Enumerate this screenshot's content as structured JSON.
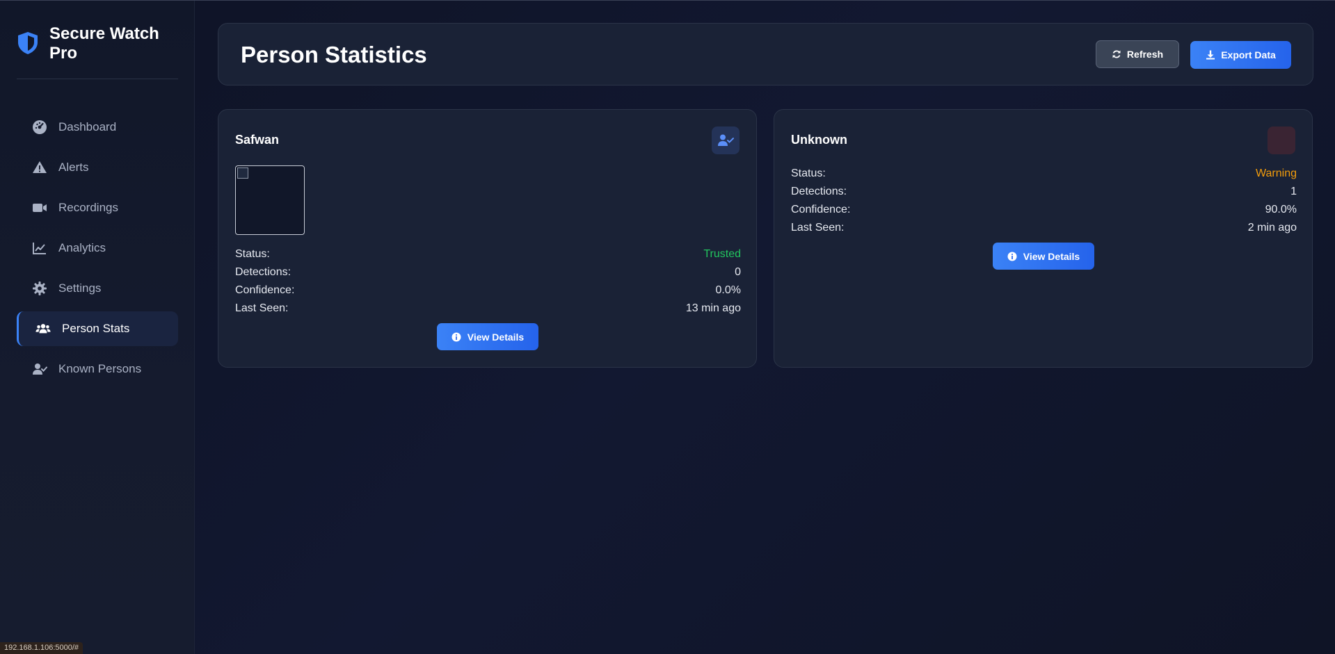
{
  "app": {
    "name": "Secure Watch Pro"
  },
  "sidebar": {
    "items": [
      {
        "label": "Dashboard",
        "icon": "dashboard-icon",
        "active": false
      },
      {
        "label": "Alerts",
        "icon": "warning-icon",
        "active": false
      },
      {
        "label": "Recordings",
        "icon": "video-icon",
        "active": false
      },
      {
        "label": "Analytics",
        "icon": "chart-line-icon",
        "active": false
      },
      {
        "label": "Settings",
        "icon": "gear-icon",
        "active": false
      },
      {
        "label": "Person Stats",
        "icon": "users-icon",
        "active": true
      },
      {
        "label": "Known Persons",
        "icon": "user-check-icon",
        "active": false
      }
    ]
  },
  "header": {
    "title": "Person Statistics",
    "refresh_label": "Refresh",
    "export_label": "Export Data"
  },
  "persons": [
    {
      "name": "Safwan",
      "status_label": "Status:",
      "status": "Trusted",
      "detections_label": "Detections:",
      "detections": "0",
      "confidence_label": "Confidence:",
      "confidence": "0.0%",
      "last_seen_label": "Last Seen:",
      "last_seen": "13 min ago",
      "button_label": "View Details"
    },
    {
      "name": "Unknown",
      "status_label": "Status:",
      "status": "Warning",
      "detections_label": "Detections:",
      "detections": "1",
      "confidence_label": "Confidence:",
      "confidence": "90.0%",
      "last_seen_label": "Last Seen:",
      "last_seen": "2 min ago",
      "button_label": "View Details"
    }
  ],
  "statusbar": {
    "url": "192.168.1.106:5000/#"
  },
  "colors": {
    "accent": "#3b82f6",
    "trusted": "#22c55e",
    "warning": "#f59e0b",
    "background": "#0f1426",
    "card": "#1a2236"
  }
}
